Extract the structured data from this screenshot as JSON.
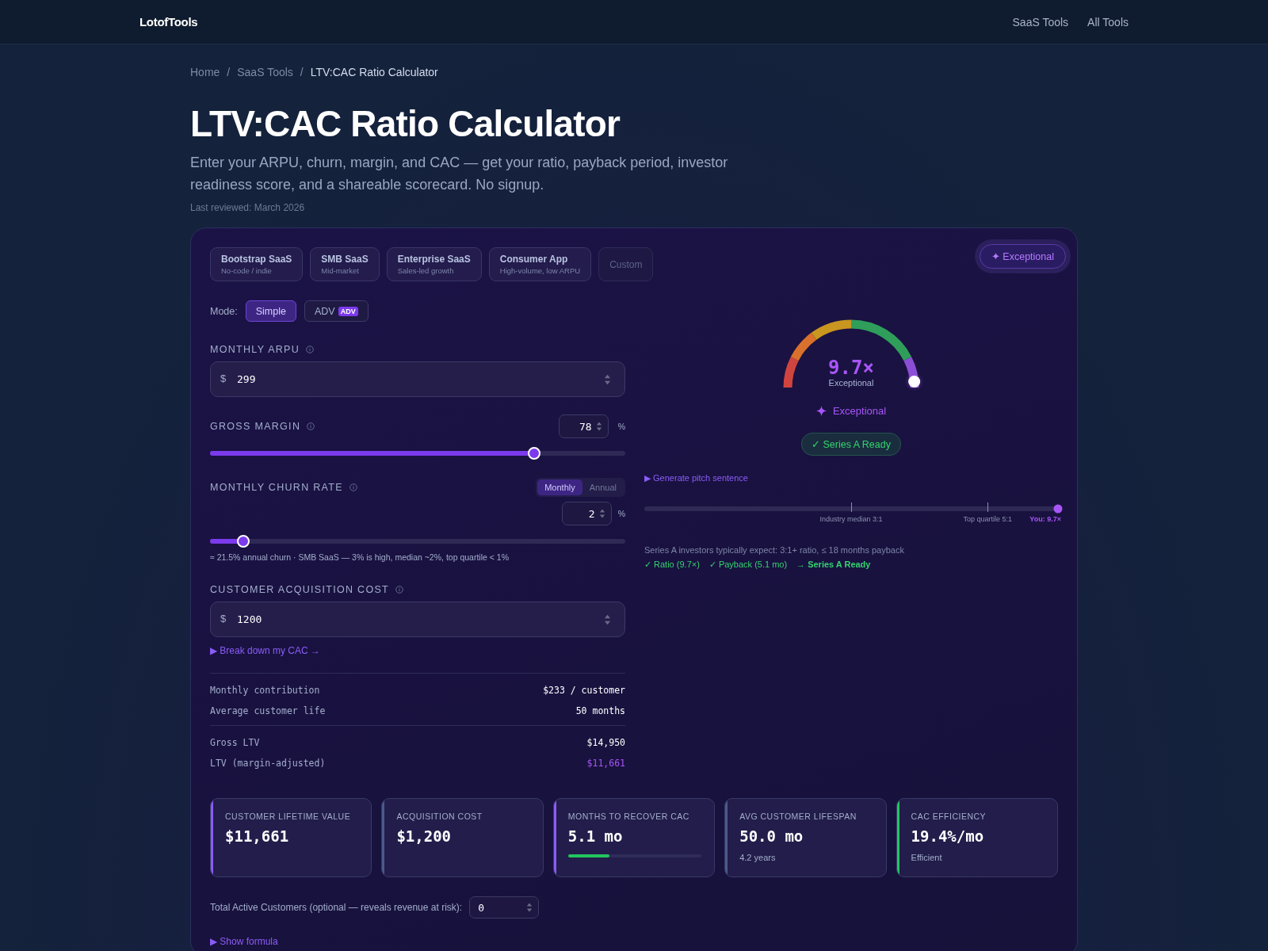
{
  "header": {
    "logo": "LotofTools",
    "nav": [
      "SaaS Tools",
      "All Tools"
    ]
  },
  "breadcrumb": {
    "separator": "/",
    "items": [
      "Home",
      "SaaS Tools",
      "LTV:CAC Ratio Calculator"
    ]
  },
  "title": "LTV:CAC Ratio Calculator",
  "subtitle": "Enter your ARPU, churn, margin, and CAC — get your ratio, payback period, investor readiness score, and a shareable scorecard. No signup.",
  "last_reviewed": "Last reviewed: March 2026",
  "presets": [
    {
      "name": "Bootstrap SaaS",
      "sub": "No-code / indie",
      "disabled": false
    },
    {
      "name": "SMB SaaS",
      "sub": "Mid-market",
      "disabled": false
    },
    {
      "name": "Enterprise SaaS",
      "sub": "Sales-led growth",
      "disabled": false
    },
    {
      "name": "Consumer App",
      "sub": "High-volume, low ARPU",
      "disabled": false
    },
    {
      "name": "Custom",
      "disabled": true
    }
  ],
  "mode": {
    "label": "Mode:",
    "options": [
      {
        "label": "Simple",
        "selected": true
      },
      {
        "label": "ADV",
        "badge": "ADV",
        "selected": false
      }
    ]
  },
  "arpu": {
    "label": "MONTHLY ARPU",
    "prefix": "$",
    "value": "299"
  },
  "margin": {
    "label": "GROSS MARGIN",
    "value": "78",
    "unit": "%",
    "level": 0.78
  },
  "churn": {
    "label": "MONTHLY CHURN RATE",
    "periods": [
      {
        "label": "Monthly",
        "selected": true
      },
      {
        "label": "Annual",
        "selected": false
      }
    ],
    "value": "2",
    "unit": "%",
    "level": 0.08,
    "hint": "≈ 21.5% annual churn · SMB SaaS — 3% is high, median ~2%, top quartile < 1%"
  },
  "cac": {
    "label": "CUSTOMER ACQUISITION COST",
    "prefix": "$",
    "value": "1200",
    "link": "▶ Break down my CAC →"
  },
  "summary": [
    [
      {
        "label": "Monthly contribution",
        "value": "$233 / customer",
        "highlight": false
      },
      {
        "label": "Average customer life",
        "value": "50 months",
        "highlight": false
      }
    ],
    [
      {
        "label": "Gross LTV",
        "value": "$14,950",
        "highlight": false
      },
      {
        "label": "LTV (margin-adjusted)",
        "value": "$11,661",
        "highlight": true
      }
    ]
  ],
  "rating_badge": "✦ Exceptional",
  "gauge": {
    "value": "9.7×",
    "caption": "Exceptional",
    "level": 0.97,
    "rating": "Exceptional"
  },
  "readiness": "✓ Series A Ready",
  "pitch_link": "▶ Generate pitch sentence",
  "benchmark": {
    "ticks": [
      {
        "label": "Industry median 3:1",
        "level": 0.5
      },
      {
        "label": "Top quartile 5:1",
        "level": 0.83
      }
    ],
    "you": {
      "label": "You: 9.7×",
      "level": 1
    }
  },
  "expectation": "Series A investors typically expect: 3:1+ ratio, ≤ 18 months payback",
  "checks": [
    "✓ Ratio (9.7×)",
    "✓ Payback (5.1 mo)"
  ],
  "verdict": "→ Series A Ready",
  "cards": [
    {
      "label": "CUSTOMER LIFETIME VALUE",
      "value": "$11,661",
      "color": "#8b5cf6"
    },
    {
      "label": "ACQUISITION COST",
      "value": "$1,200",
      "color": "#4b5a8c"
    },
    {
      "label": "MONTHS TO RECOVER CAC",
      "value": "5.1 mo",
      "color": "#8b5cf6",
      "level": 0.31
    },
    {
      "label": "AVG CUSTOMER LIFESPAN",
      "value": "50.0 mo",
      "sub": "4.2 years",
      "color": "#4b5a8c"
    },
    {
      "label": "CAC EFFICIENCY",
      "value": "19.4%/mo",
      "sub": "Efficient",
      "color": "#22c55e"
    }
  ],
  "customers": {
    "label": "Total Active Customers (optional — reveals revenue at risk):",
    "value": "0"
  },
  "formula_link": "▶ Show formula"
}
